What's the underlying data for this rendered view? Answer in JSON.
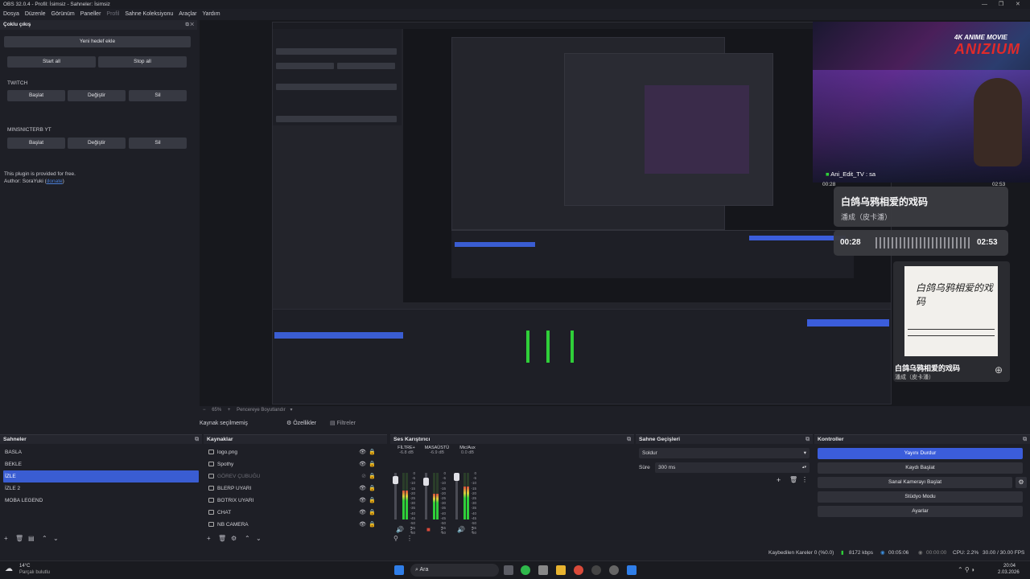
{
  "window": {
    "title": "OBS 32.0.4 - Profil: İsimsiz - Sahneler: İsimsiz"
  },
  "menu": {
    "items": [
      "Dosya",
      "Düzenle",
      "Görünüm",
      "Paneller",
      "Profil",
      "Sahne Koleksiyonu",
      "Araçlar",
      "Yardım"
    ]
  },
  "multi_output": {
    "title": "Çoklu çıkış",
    "add_target": "Yeni hedef ekle",
    "start_all": "Start all",
    "stop_all": "Stop all",
    "targets": [
      {
        "name": "TWITCH",
        "start": "Başlat",
        "edit": "Değiştir",
        "delete": "Sil"
      },
      {
        "name": "MINSNICTERB YT",
        "start": "Başlat",
        "edit": "Değiştir",
        "delete": "Sil"
      }
    ],
    "note": "This plugin is provided for free.",
    "author_prefix": "Author: SoraYuki (",
    "author_link": "donate",
    "author_suffix": ")"
  },
  "overlay": {
    "brand_tag": "4K ANIME MOVIE",
    "brand": "ANIZIUM",
    "chat_user": "Ani_Edit_TV : sa",
    "track_title": "白鸽乌鸦相爱的戏码",
    "track_artist": "潘成（皮卡潘）",
    "time_elapsed": "00:28",
    "time_total": "02:53",
    "album_title": "白鸽乌鸦相爱的戏码",
    "album_artist": "潘成（皮卡潘）",
    "album_art_text": "白鸽乌鸦相爱的戏码"
  },
  "preview_bar": {
    "zoom": "65%",
    "resize": "Pencereye Boyutlandır"
  },
  "context": {
    "no_source": "Kaynak seçilmemiş",
    "properties": "Özellikler",
    "filters": "Filtreler"
  },
  "scenes": {
    "title": "Sahneler",
    "items": [
      "BASLA",
      "BEKLE",
      "İZLE",
      "İZLE 2",
      "MOBA LEGEND"
    ],
    "selected": 2
  },
  "sources": {
    "title": "Kaynaklar",
    "items": [
      {
        "name": "logo.png",
        "hidden": false
      },
      {
        "name": "Spothy",
        "hidden": false
      },
      {
        "name": "GÖREV ÇUBUĞU",
        "hidden": true
      },
      {
        "name": "BLERP UYARI",
        "hidden": false
      },
      {
        "name": "BOTRIX UYARI",
        "hidden": false
      },
      {
        "name": "CHAT",
        "hidden": false
      },
      {
        "name": "NB CAMERA",
        "hidden": false
      }
    ]
  },
  "mixer": {
    "title": "Ses Karıştırıcı",
    "channels": [
      {
        "name": "FİLTRE+",
        "db": "-6.8 dB",
        "level": 0.62
      },
      {
        "name": "MASAÜSTÜ",
        "db": "-6.9 dB",
        "level": 0.55
      },
      {
        "name": "Mic/Aux",
        "db": "0.0 dB",
        "level": 0.7
      }
    ],
    "scale": [
      "0",
      "-5",
      "-10",
      "-15",
      "-20",
      "-25",
      "-30",
      "-35",
      "-40",
      "-45",
      "-50",
      "-55",
      "-60"
    ]
  },
  "transitions": {
    "title": "Sahne Geçişleri",
    "type": "Soldur",
    "duration_label": "Süre",
    "duration": "300 ms"
  },
  "controls": {
    "title": "Kontroller",
    "buttons": [
      "Yayını Durdur",
      "Kaydı Başlat",
      "Sanal Kamerayı Başlat",
      "Stüdyo Modu",
      "Ayarlar"
    ]
  },
  "status": {
    "dropped": "Kaybedilen Kareler 0 (%0.0)",
    "bitrate": "8172 kbps",
    "stream_time": "00:05:06",
    "rec_time": "00:00:00",
    "cpu": "CPU: 2.2%",
    "fps": "30.00 / 30.00 FPS"
  },
  "taskbar": {
    "weather_temp": "14°C",
    "weather_desc": "Parçalı bulutlu",
    "search": "Ara",
    "time": "20:04",
    "date": "2.03.2026"
  },
  "colors": {
    "accent": "#3b5ddb",
    "background": "#1e1f26",
    "meter_green": "#2fcf39"
  }
}
